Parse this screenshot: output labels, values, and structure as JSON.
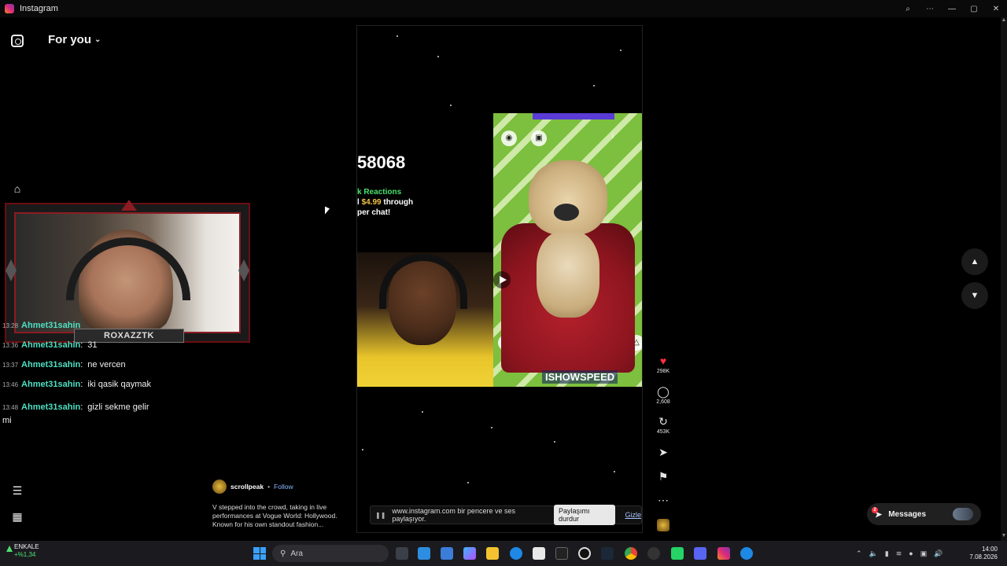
{
  "window": {
    "title": "Instagram",
    "controls": [
      "⌕",
      "⋯",
      "—",
      "▢",
      "✕"
    ]
  },
  "header": {
    "feed_label": "For you",
    "chevron": "chevron-down-icon"
  },
  "sidebar": {
    "menu_icon": "menu-icon",
    "apps_icon": "apps-icon"
  },
  "webcam": {
    "nameplate": "ROXAZZTK"
  },
  "chat": [
    {
      "time": "13:28",
      "user": "Ahmet31sahin",
      "text": ""
    },
    {
      "time": "13:36",
      "user": "Ahmet31sahin",
      "text": "31"
    },
    {
      "time": "13:37",
      "user": "Ahmet31sahin",
      "text": "ne vercen"
    },
    {
      "time": "13:46",
      "user": "Ahmet31sahin",
      "text": "iki qasik qaymak"
    },
    {
      "time": "13:48",
      "user": "Ahmet31sahin",
      "text": "gizli sekme gelir mi"
    }
  ],
  "video": {
    "counter": "58068",
    "reactions_label": "k Reactions",
    "price_prefix": "l ",
    "price": "$4.99",
    "price_suffix": " through",
    "super_chat": "per chat!",
    "brand": "ISHOWSPEED",
    "share_bar": {
      "message": "www.instagram.com bir pencere ve ses paylaşıyor.",
      "stop_label": "Paylaşımı durdur",
      "hide_label": "Gizle"
    }
  },
  "post": {
    "username": "scrollpeak",
    "separator": "•",
    "follow_label": "Follow",
    "caption": "V stepped into the crowd, taking in live performances at Vogue World: Hollywood. Known for his own standout fashion..."
  },
  "actions": {
    "likes": "298K",
    "comments": "2,608",
    "reposts": "453K"
  },
  "messages": {
    "label": "Messages",
    "badge": "2"
  },
  "taskbar": {
    "stock_name": "ENKALE",
    "stock_change": "+%1,34",
    "search_placeholder": "Ara",
    "time": "14:00",
    "date": "7.08.2026"
  },
  "colors": {
    "accent_chat_user": "#4ee0c2",
    "like": "#ff3040",
    "link": "#8fb8ff"
  }
}
